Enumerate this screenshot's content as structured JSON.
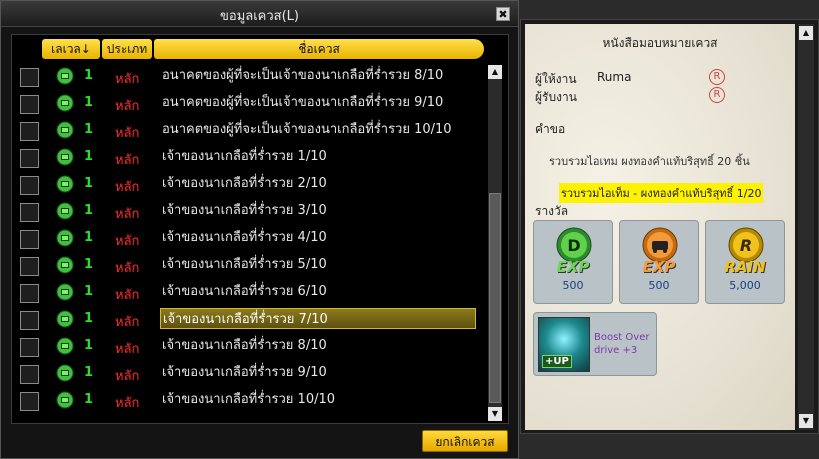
{
  "window": {
    "title": "ขอมูลเควส(L)",
    "close_label": "✖"
  },
  "list": {
    "headers": {
      "level": "เลเวล↓",
      "type": "ประเภท",
      "name": "ชื่อเควส"
    },
    "rows": [
      {
        "level": "1",
        "type": "หลัก",
        "name": "อนาคตของผู้ที่จะเป็นเจ้าของนาเกลือที่ร่ำรวย 8/10",
        "selected": false
      },
      {
        "level": "1",
        "type": "หลัก",
        "name": "อนาคตของผู้ที่จะเป็นเจ้าของนาเกลือที่ร่ำรวย 9/10",
        "selected": false
      },
      {
        "level": "1",
        "type": "หลัก",
        "name": "อนาคตของผู้ที่จะเป็นเจ้าของนาเกลือที่ร่ำรวย 10/10",
        "selected": false
      },
      {
        "level": "1",
        "type": "หลัก",
        "name": "เจ้าของนาเกลือที่ร่ำรวย 1/10",
        "selected": false
      },
      {
        "level": "1",
        "type": "หลัก",
        "name": "เจ้าของนาเกลือที่ร่ำรวย 2/10",
        "selected": false
      },
      {
        "level": "1",
        "type": "หลัก",
        "name": "เจ้าของนาเกลือที่ร่ำรวย 3/10",
        "selected": false
      },
      {
        "level": "1",
        "type": "หลัก",
        "name": "เจ้าของนาเกลือที่ร่ำรวย 4/10",
        "selected": false
      },
      {
        "level": "1",
        "type": "หลัก",
        "name": "เจ้าของนาเกลือที่ร่ำรวย 5/10",
        "selected": false
      },
      {
        "level": "1",
        "type": "หลัก",
        "name": "เจ้าของนาเกลือที่ร่ำรวย 6/10",
        "selected": false
      },
      {
        "level": "1",
        "type": "หลัก",
        "name": "เจ้าของนาเกลือที่ร่ำรวย 7/10",
        "selected": true
      },
      {
        "level": "1",
        "type": "หลัก",
        "name": "เจ้าของนาเกลือที่ร่ำรวย 8/10",
        "selected": false
      },
      {
        "level": "1",
        "type": "หลัก",
        "name": "เจ้าของนาเกลือที่ร่ำรวย 9/10",
        "selected": false
      },
      {
        "level": "1",
        "type": "หลัก",
        "name": "เจ้าของนาเกลือที่ร่ำรวย 10/10",
        "selected": false
      }
    ],
    "cancel_label": "ยกเลิกเควส"
  },
  "detail": {
    "title": "หนังสือมอบหมายเควส",
    "giver_label": "ผู้ให้งาน",
    "giver_value": "Ruma",
    "receiver_label": "ผู้รับงาน",
    "giver_mark": "R",
    "receiver_mark": "R",
    "request_label": "คำขอ",
    "request_text": "รวบรวมไอเทม ผงทองคำแท้บริสุทธิ์ 20 ชิ้น",
    "request_progress": "รวบรวมไอเท็ม - ผงทองคำแท้บริสุทธิ์ 1/20",
    "reward_label": "รางวัล",
    "rewards": [
      {
        "word": "EXP",
        "value": "500",
        "icon": "driver-exp-icon",
        "color": "#6fd35a"
      },
      {
        "word": "EXP",
        "value": "500",
        "icon": "car-exp-icon",
        "color": "#f39b3a"
      },
      {
        "word": "RAIN",
        "value": "5,000",
        "icon": "rain-coin-icon",
        "color": "#f2c21c"
      }
    ],
    "item": {
      "name": "Boost Over drive +3",
      "badge": "+UP"
    }
  }
}
